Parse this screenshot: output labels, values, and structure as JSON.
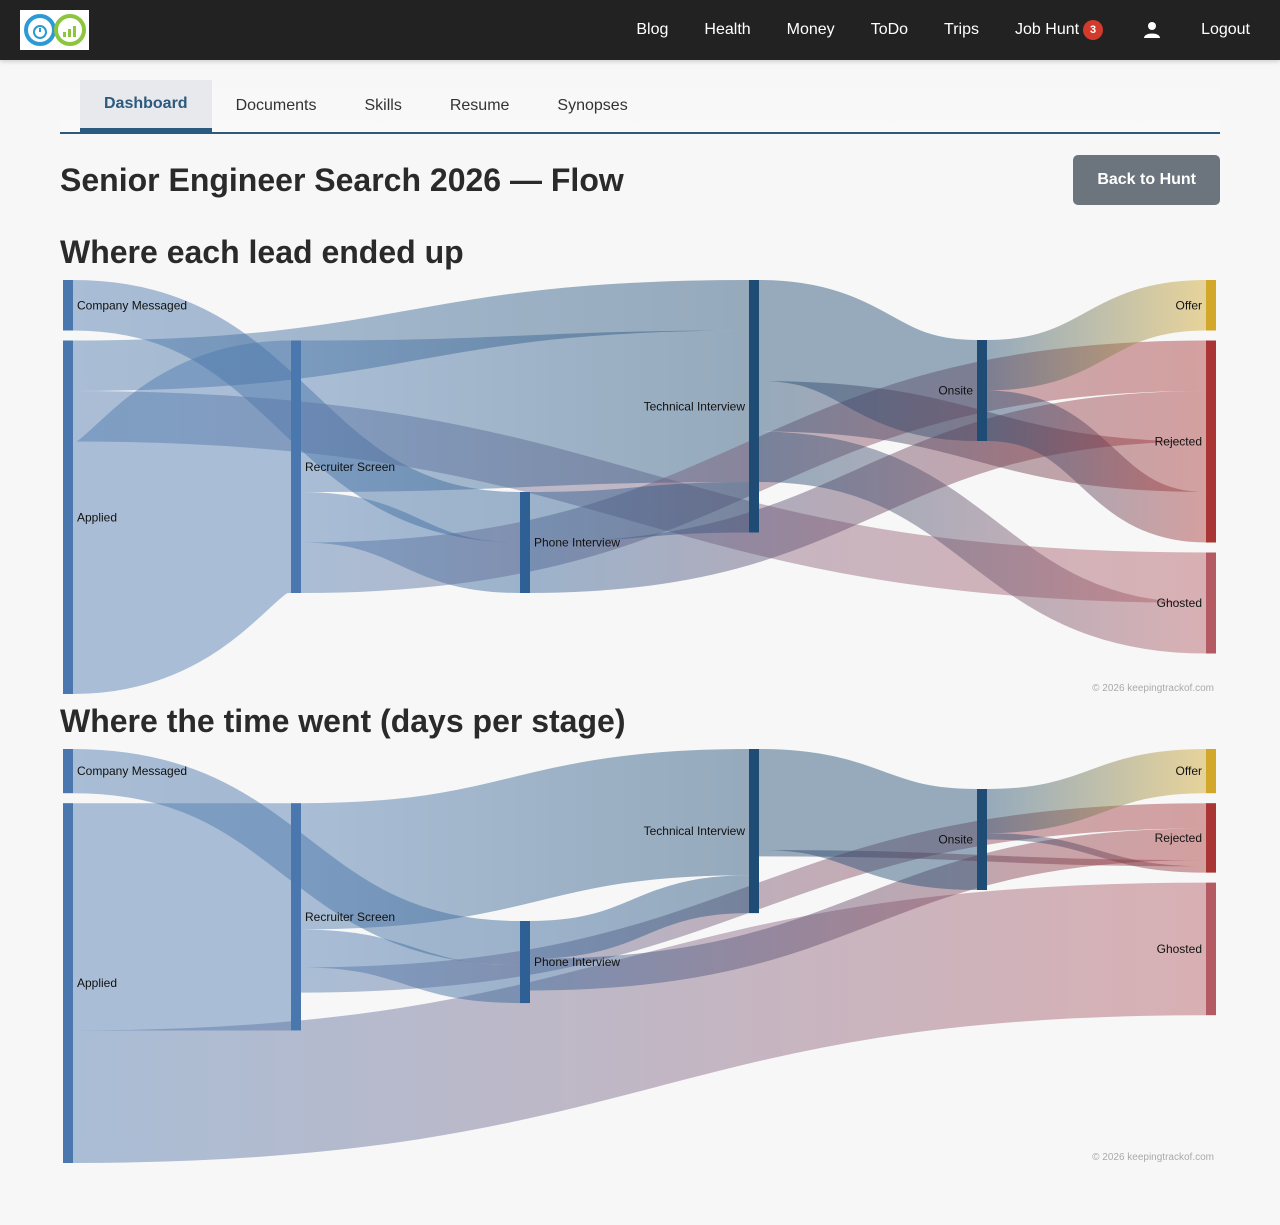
{
  "nav": {
    "items": [
      {
        "label": "Blog"
      },
      {
        "label": "Health"
      },
      {
        "label": "Money"
      },
      {
        "label": "ToDo"
      },
      {
        "label": "Trips"
      },
      {
        "label": "Job Hunt",
        "badge": "3"
      },
      {
        "label": "Logout"
      }
    ],
    "badge_color": "#d23a2c"
  },
  "tabs": [
    {
      "label": "Dashboard",
      "active": true
    },
    {
      "label": "Documents"
    },
    {
      "label": "Skills"
    },
    {
      "label": "Resume"
    },
    {
      "label": "Synopses"
    }
  ],
  "page": {
    "title": "Senior Engineer Search 2026 — Flow",
    "back_label": "Back to Hunt"
  },
  "colors": {
    "source": "#4a77ad",
    "stage": "#2e5f95",
    "deep": "#1f4c74",
    "offer": "#d3a72a",
    "rejected": "#a93535",
    "ghosted": "#b35a62"
  },
  "chart_data": [
    {
      "type": "sankey",
      "title": "Where each lead ended up",
      "nodes": [
        "Company Messaged",
        "Applied",
        "Recruiter Screen",
        "Phone Interview",
        "Technical Interview",
        "Onsite",
        "Offer",
        "Rejected",
        "Ghosted"
      ],
      "links": [
        {
          "source": "Company Messaged",
          "target": "Phone Interview",
          "value": 1
        },
        {
          "source": "Applied",
          "target": "Technical Interview",
          "value": 1
        },
        {
          "source": "Applied",
          "target": "Ghosted",
          "value": 1
        },
        {
          "source": "Applied",
          "target": "Recruiter Screen",
          "value": 5
        },
        {
          "source": "Recruiter Screen",
          "target": "Technical Interview",
          "value": 3
        },
        {
          "source": "Recruiter Screen",
          "target": "Phone Interview",
          "value": 1
        },
        {
          "source": "Recruiter Screen",
          "target": "Rejected",
          "value": 1
        },
        {
          "source": "Phone Interview",
          "target": "Technical Interview",
          "value": 1
        },
        {
          "source": "Phone Interview",
          "target": "Rejected",
          "value": 1
        },
        {
          "source": "Technical Interview",
          "target": "Onsite",
          "value": 2
        },
        {
          "source": "Technical Interview",
          "target": "Rejected",
          "value": 1
        },
        {
          "source": "Technical Interview",
          "target": "Ghosted",
          "value": 1
        },
        {
          "source": "Onsite",
          "target": "Offer",
          "value": 1
        },
        {
          "source": "Onsite",
          "target": "Rejected",
          "value": 1
        }
      ],
      "copyright": "© 2026 keepingtrackof.com"
    },
    {
      "type": "sankey",
      "title": "Where the time went (days per stage)",
      "nodes": [
        "Company Messaged",
        "Applied",
        "Recruiter Screen",
        "Phone Interview",
        "Technical Interview",
        "Onsite",
        "Offer",
        "Rejected",
        "Ghosted"
      ],
      "links": [
        {
          "source": "Company Messaged",
          "target": "Phone Interview",
          "value": 7
        },
        {
          "source": "Applied",
          "target": "Recruiter Screen",
          "value": 36
        },
        {
          "source": "Applied",
          "target": "Ghosted",
          "value": 21
        },
        {
          "source": "Recruiter Screen",
          "target": "Technical Interview",
          "value": 20
        },
        {
          "source": "Recruiter Screen",
          "target": "Phone Interview",
          "value": 6
        },
        {
          "source": "Recruiter Screen",
          "target": "Rejected",
          "value": 4
        },
        {
          "source": "Phone Interview",
          "target": "Technical Interview",
          "value": 6
        },
        {
          "source": "Phone Interview",
          "target": "Rejected",
          "value": 5
        },
        {
          "source": "Technical Interview",
          "target": "Onsite",
          "value": 16
        },
        {
          "source": "Technical Interview",
          "target": "Rejected",
          "value": 1
        },
        {
          "source": "Onsite",
          "target": "Offer",
          "value": 7
        },
        {
          "source": "Onsite",
          "target": "Rejected",
          "value": 1
        }
      ],
      "copyright": "© 2026 keepingtrackof.com"
    }
  ]
}
